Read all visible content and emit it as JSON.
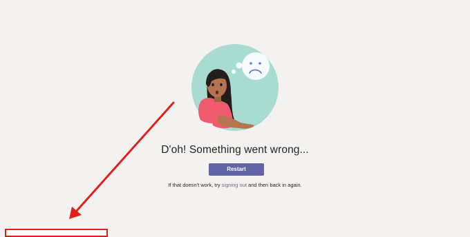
{
  "error": {
    "title": "D'oh! Something went wrong...",
    "restart_label": "Restart",
    "help_prefix": "If that doesn't work, try ",
    "help_link": "signing out",
    "help_suffix": " and then back in again."
  },
  "illustration": {
    "icons": [
      "sad-face-icon",
      "thought-bubble-icon"
    ],
    "colors": {
      "circle": "#a8dbd2",
      "shirt": "#f05a6e",
      "skin": "#b57450",
      "hair": "#251c1c",
      "bubble": "#f6fbff",
      "face": "#5d7fd6"
    }
  },
  "annotation": {
    "arrow_color": "#e0201c",
    "box_color": "#e0201c"
  },
  "theme": {
    "background": "#f3f2f1",
    "accent": "#6264a7",
    "text": "#252423"
  }
}
